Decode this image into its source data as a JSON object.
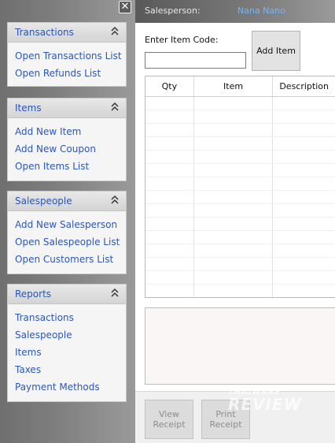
{
  "sidebar": {
    "close_symbol": "✕",
    "panels": [
      {
        "title": "Transactions",
        "links": [
          "Open Transactions List",
          "Open Refunds List"
        ]
      },
      {
        "title": "Items",
        "links": [
          "Add New Item",
          "Add New Coupon",
          "Open Items List"
        ]
      },
      {
        "title": "Salespeople",
        "links": [
          "Add New Salesperson",
          "Open Salespeople List",
          "Open Customers List"
        ]
      },
      {
        "title": "Reports",
        "links": [
          "Transactions",
          "Salespeople",
          "Items",
          "Taxes",
          "Payment Methods"
        ]
      }
    ]
  },
  "header": {
    "salesperson_label": "Salesperson:",
    "salesperson_value": "Nana Nano"
  },
  "item_entry": {
    "label": "Enter Item Code:",
    "value": "",
    "add_button": "Add Item"
  },
  "table": {
    "columns": [
      "Qty",
      "Item",
      "Description"
    ],
    "rows": []
  },
  "footer": {
    "view_receipt_line1": "View",
    "view_receipt_line2": "Receipt",
    "print_receipt_line1": "Print",
    "print_receipt_line2": "Receipt"
  },
  "watermark": {
    "top": "THAIWARE",
    "bottom": "REVIEW"
  },
  "colors": {
    "link": "#2d57b4",
    "salesperson_value": "#6fb6ff"
  }
}
